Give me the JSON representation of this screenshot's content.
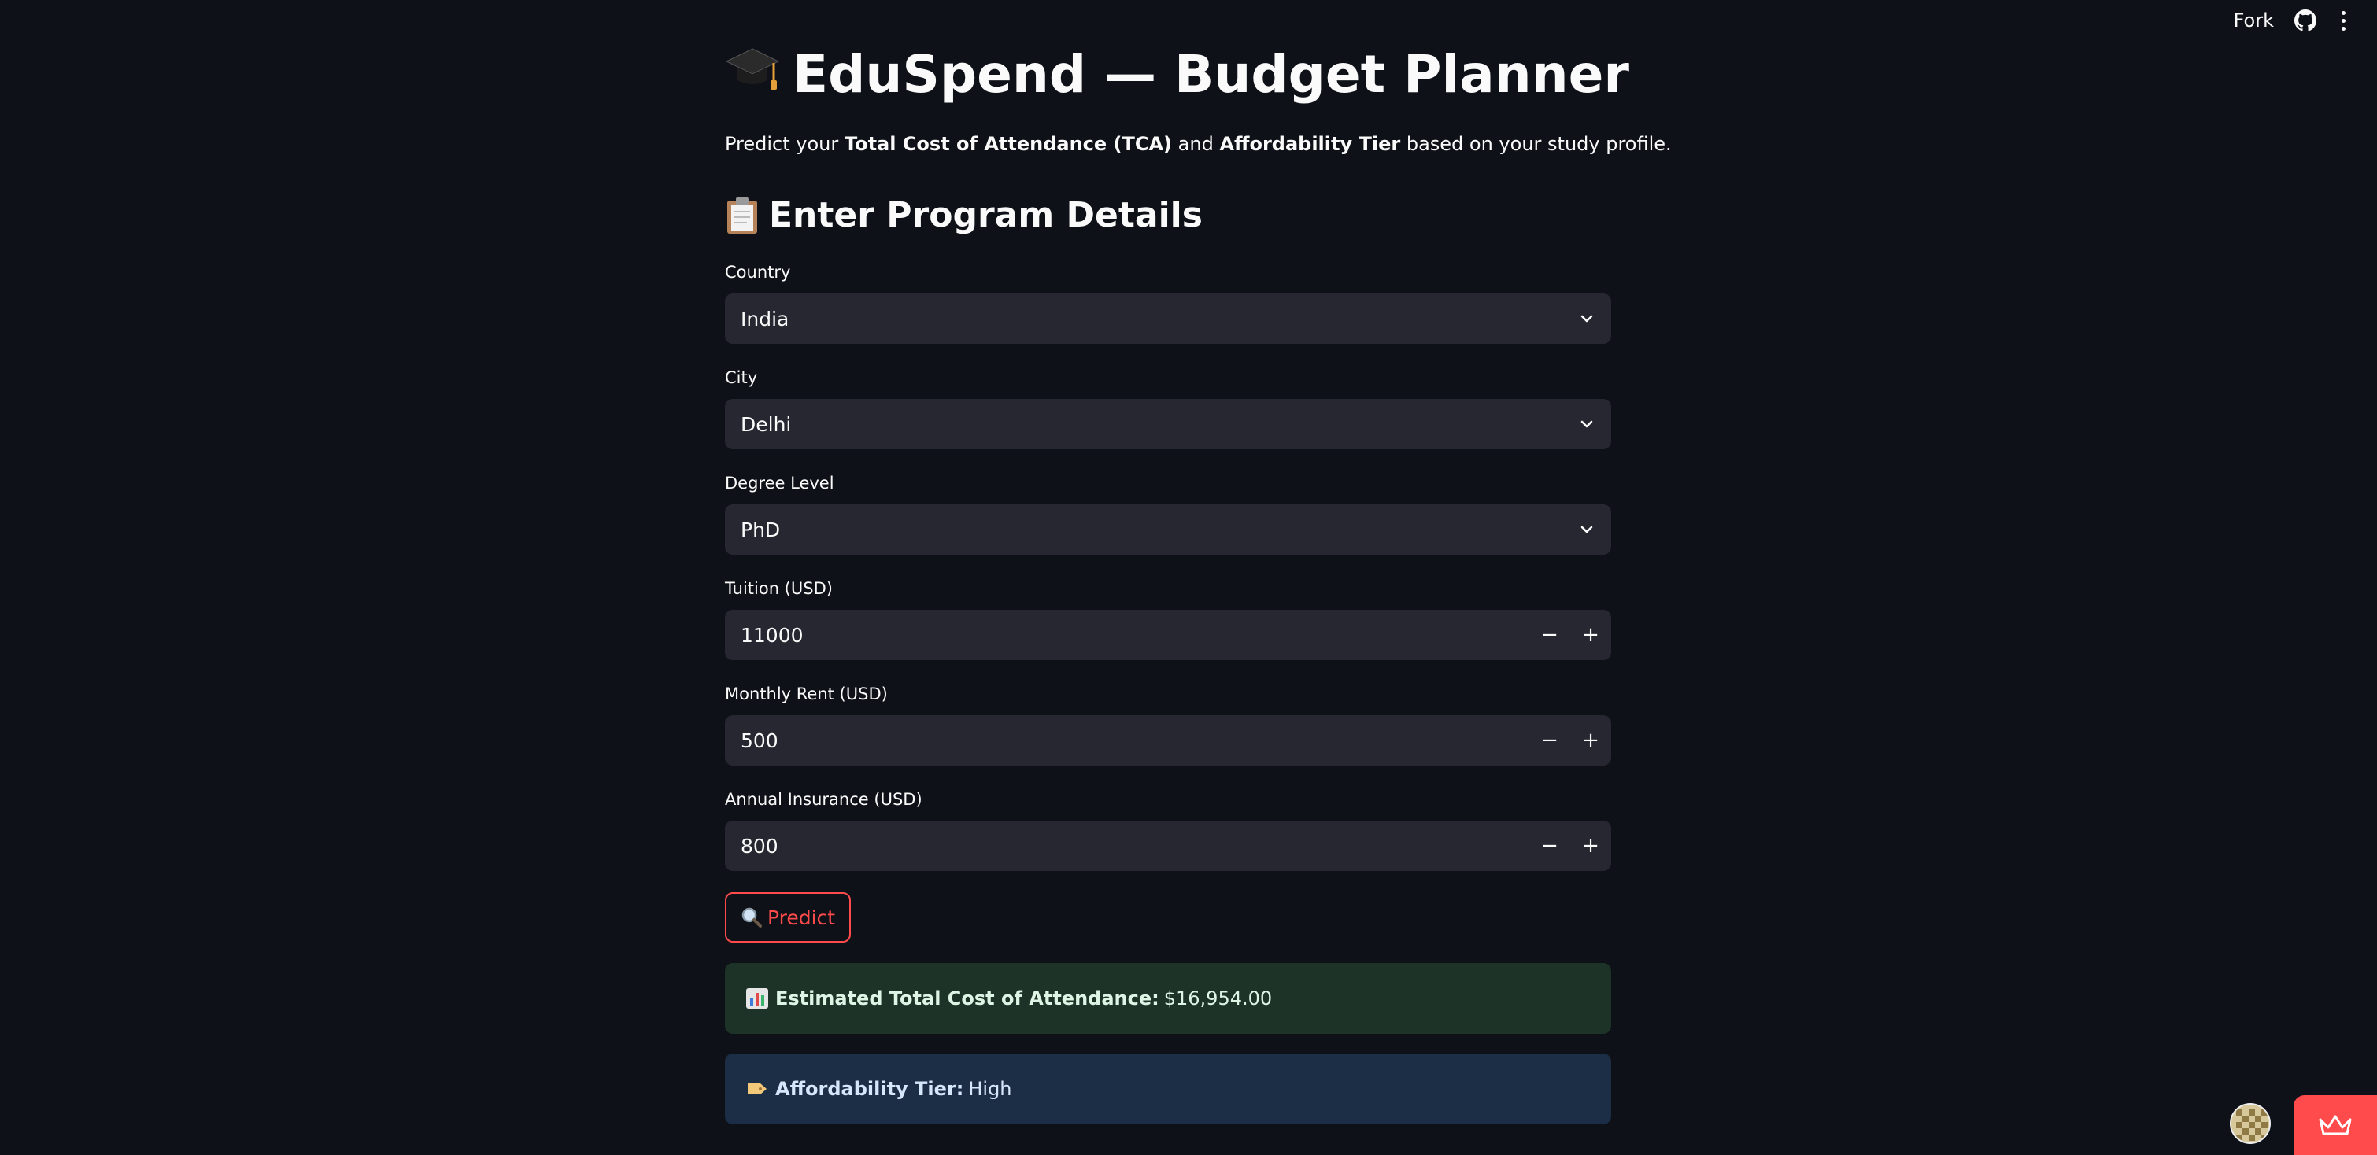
{
  "toolbar": {
    "fork_label": "Fork",
    "icons": [
      "github-icon",
      "more-vert-icon"
    ]
  },
  "header": {
    "title": "EduSpend — Budget Planner",
    "title_icon": "graduation-cap-icon",
    "intro_before": "Predict your ",
    "intro_bold1": "Total Cost of Attendance (TCA)",
    "intro_mid": " and ",
    "intro_bold2": "Affordability Tier",
    "intro_after": " based on your study profile."
  },
  "form": {
    "section_title": "Enter Program Details",
    "section_icon": "clipboard-icon",
    "country": {
      "label": "Country",
      "value": "India"
    },
    "city": {
      "label": "City",
      "value": "Delhi"
    },
    "degree": {
      "label": "Degree Level",
      "value": "PhD"
    },
    "tuition": {
      "label": "Tuition (USD)",
      "value": "11000"
    },
    "rent": {
      "label": "Monthly Rent (USD)",
      "value": "500"
    },
    "insurance": {
      "label": "Annual Insurance (USD)",
      "value": "800"
    },
    "minus": "−",
    "plus": "+",
    "predict_label": "Predict",
    "predict_icon": "magnifier-icon"
  },
  "results": {
    "tca_label": "Estimated Total Cost of Attendance:",
    "tca_value": "$16,954.00",
    "tca_icon": "bar-chart-icon",
    "tier_label": "Affordability Tier:",
    "tier_value": "High",
    "tier_icon": "label-tag-icon"
  },
  "colors": {
    "background": "#0e1117",
    "input_bg": "#262730",
    "accent": "#ff4b4b",
    "success_bg": "#1e3328",
    "info_bg": "#1c2d46"
  }
}
